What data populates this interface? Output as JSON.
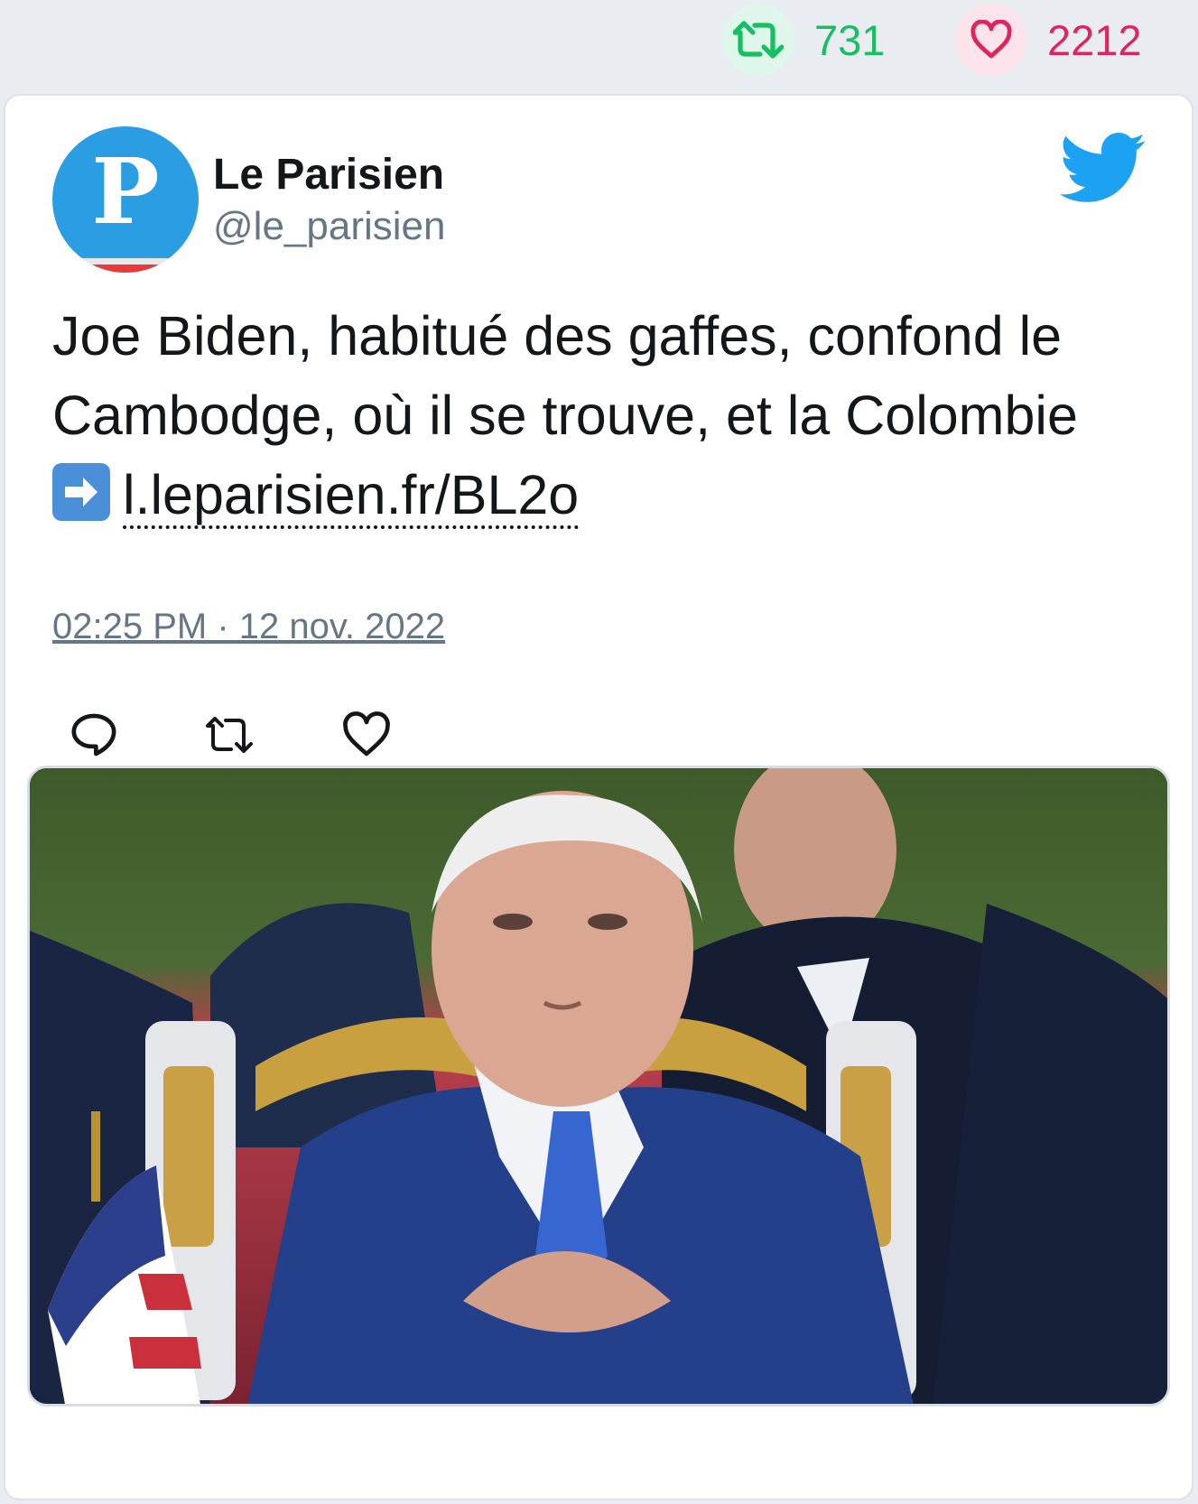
{
  "stats": {
    "retweets": "731",
    "likes": "2212"
  },
  "author": {
    "name": "Le Parisien",
    "handle": "@le_parisien",
    "avatar_letter": "P"
  },
  "tweet": {
    "text": "Joe Biden, habitué des gaffes, confond le Cambodge, où il se trouve, et la Colombie ",
    "link_text": "l.leparisien.fr/BL2o",
    "timestamp": "02:25 PM · 12 nov. 2022"
  },
  "icons": {
    "retweet": "retweet-icon",
    "like": "heart-icon",
    "reply": "reply-icon",
    "brand": "twitter-bird-icon",
    "emoji": "right-arrow-emoji"
  },
  "colors": {
    "retweet": "#17bf63",
    "like": "#e0245e",
    "twitter_blue": "#1da1f2",
    "avatar_bg": "#2a9de3"
  }
}
